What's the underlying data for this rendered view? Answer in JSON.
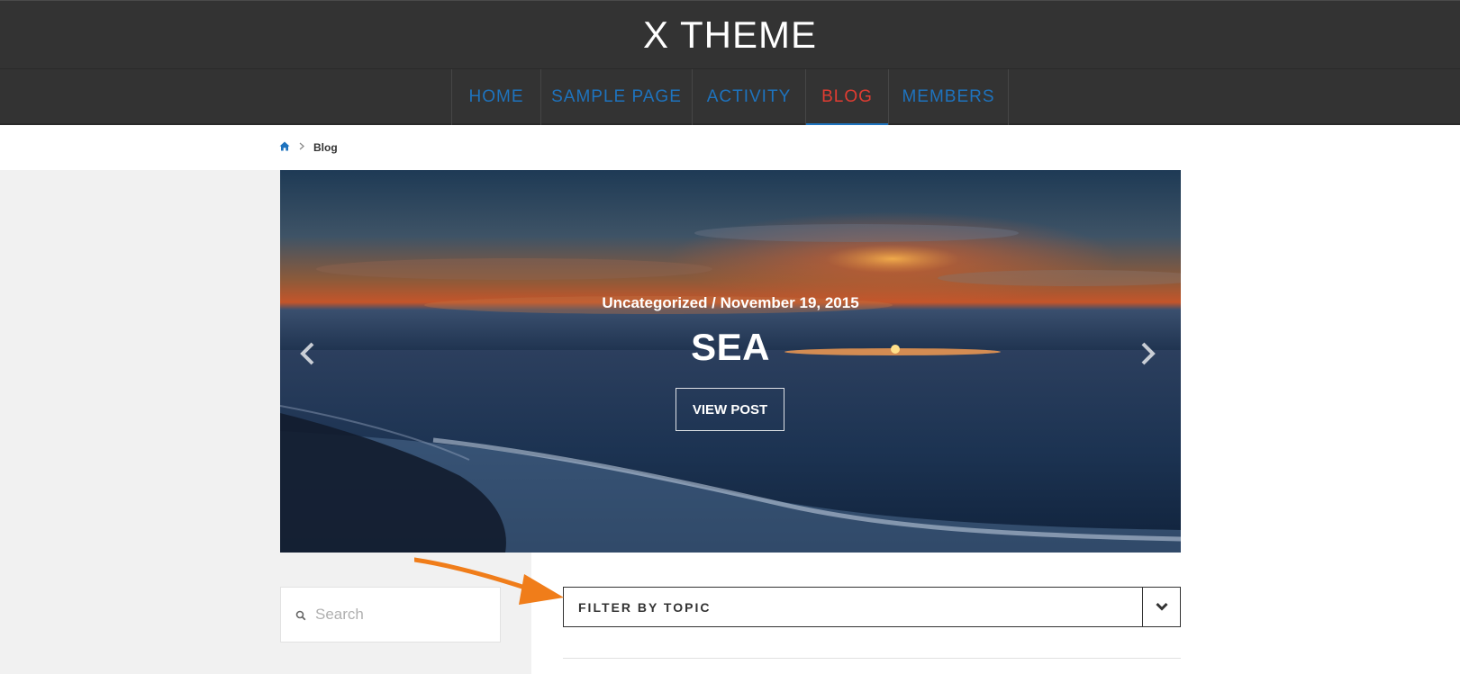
{
  "site": {
    "title": "X THEME"
  },
  "nav": {
    "items": [
      {
        "label": "HOME"
      },
      {
        "label": "SAMPLE PAGE"
      },
      {
        "label": "ACTIVITY"
      },
      {
        "label": "BLOG"
      },
      {
        "label": "MEMBERS"
      }
    ],
    "active_index": 3
  },
  "breadcrumb": {
    "home_icon": "home-icon",
    "separator_icon": "chevron-right-icon",
    "current": "Blog"
  },
  "slider": {
    "meta": "Uncategorized / November 19, 2015",
    "title": "SEA",
    "button_label": "VIEW POST",
    "prev_icon": "chevron-left-icon",
    "next_icon": "chevron-right-icon"
  },
  "search": {
    "placeholder": "Search",
    "icon": "search-icon"
  },
  "filter": {
    "label": "FILTER BY TOPIC",
    "icon": "chevron-down-icon"
  },
  "colors": {
    "header_bg": "#333333",
    "nav_link": "#1e73be",
    "nav_active": "#e03c31",
    "annotation_arrow": "#f07d1a"
  }
}
